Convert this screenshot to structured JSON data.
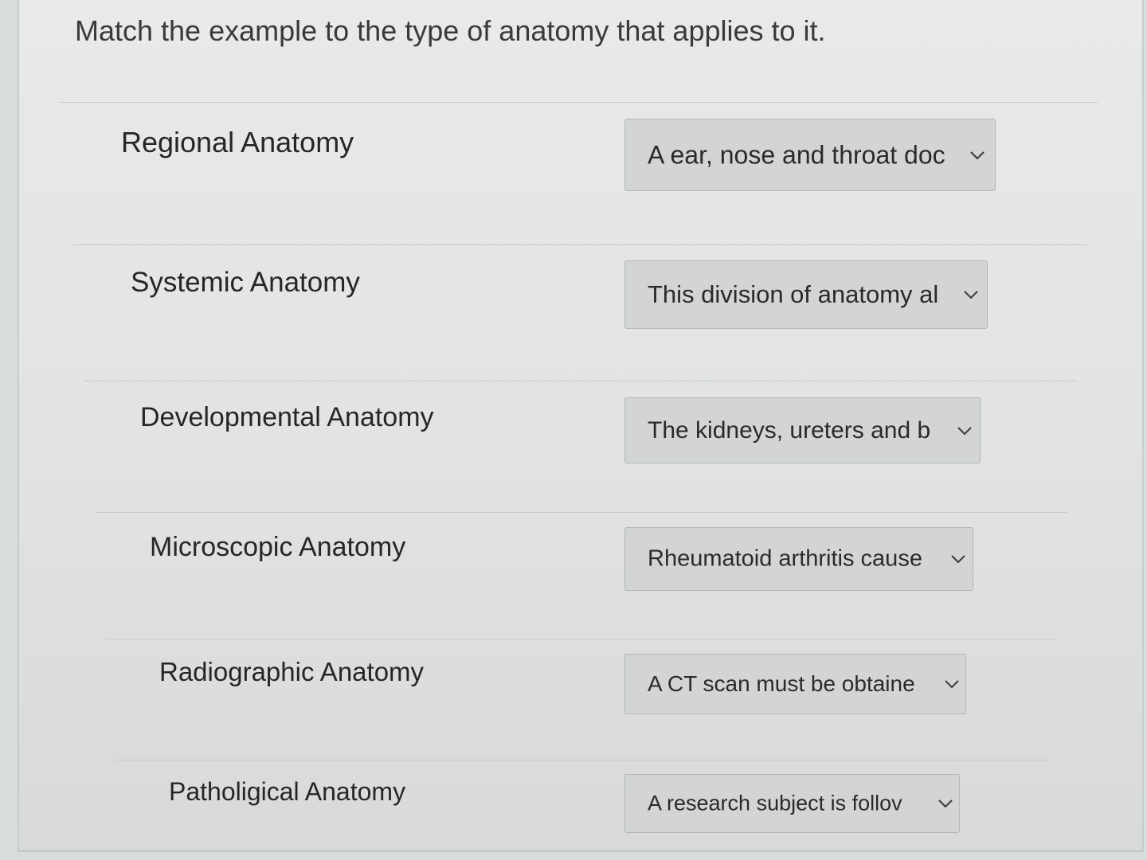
{
  "question": {
    "prompt": "Match the example to the type of anatomy that applies to it."
  },
  "rows": [
    {
      "label": "Regional Anatomy",
      "selected": "A ear, nose and throat doc"
    },
    {
      "label": "Systemic Anatomy",
      "selected": "This division of anatomy al"
    },
    {
      "label": "Developmental Anatomy",
      "selected": "The kidneys, ureters and b"
    },
    {
      "label": "Microscopic Anatomy",
      "selected": "Rheumatoid arthritis cause"
    },
    {
      "label": "Radiographic Anatomy",
      "selected": "A CT scan must be obtaine"
    },
    {
      "label": "Patholigical Anatomy",
      "selected": "A research subject is follov"
    }
  ],
  "icons": {
    "dropdown": "chevron-down-icon"
  }
}
